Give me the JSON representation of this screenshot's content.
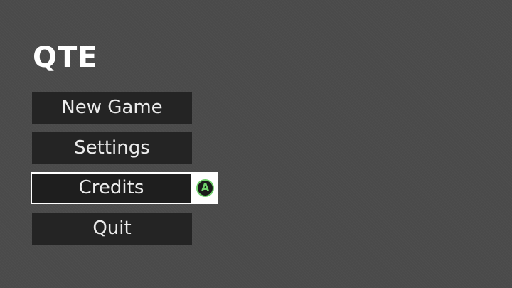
{
  "game": {
    "title": "QTE"
  },
  "menu": {
    "items": [
      {
        "label": "New Game"
      },
      {
        "label": "Settings"
      },
      {
        "label": "Credits"
      },
      {
        "label": "Quit"
      }
    ],
    "selected": "Credits",
    "confirm_prompt": {
      "button": "A",
      "color": "#6fd06a"
    }
  }
}
